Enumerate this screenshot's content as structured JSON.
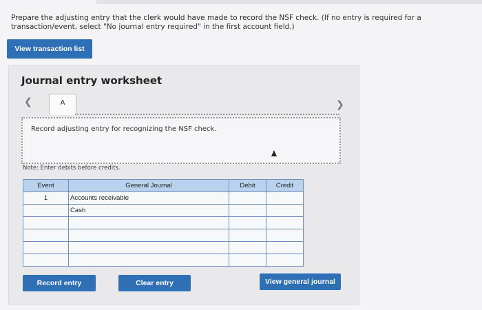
{
  "instructions": {
    "main": "Prepare the adjusting entry that the clerk would have made to record the NSF check.",
    "note": "(If no entry is required for a transaction/event, select \"No journal entry required\" in the first account field.)"
  },
  "buttons": {
    "view_transaction_list": "View transaction list",
    "record_entry": "Record entry",
    "clear_entry": "Clear entry",
    "view_general_journal": "View general journal"
  },
  "worksheet": {
    "title": "Journal entry worksheet",
    "prev_icon": "chevron-left-icon",
    "next_icon": "chevron-right-icon",
    "tab_label": "A",
    "entry_description": "Record adjusting entry for recognizing the NSF check.",
    "debits_note": "Note: Enter debits before credits."
  },
  "journal": {
    "headers": [
      "Event",
      "General Journal",
      "Debit",
      "Credit"
    ],
    "rows": [
      {
        "event": "1",
        "account": "Accounts receivable",
        "debit": "",
        "credit": ""
      },
      {
        "event": "",
        "account": "Cash",
        "debit": "",
        "credit": ""
      },
      {
        "event": "",
        "account": "",
        "debit": "",
        "credit": ""
      },
      {
        "event": "",
        "account": "",
        "debit": "",
        "credit": ""
      },
      {
        "event": "",
        "account": "",
        "debit": "",
        "credit": ""
      },
      {
        "event": "",
        "account": "",
        "debit": "",
        "credit": ""
      }
    ]
  },
  "colors": {
    "primary_button": "#2f6fb6",
    "table_header": "#b9d3ee",
    "table_border": "#6b8fb8"
  }
}
